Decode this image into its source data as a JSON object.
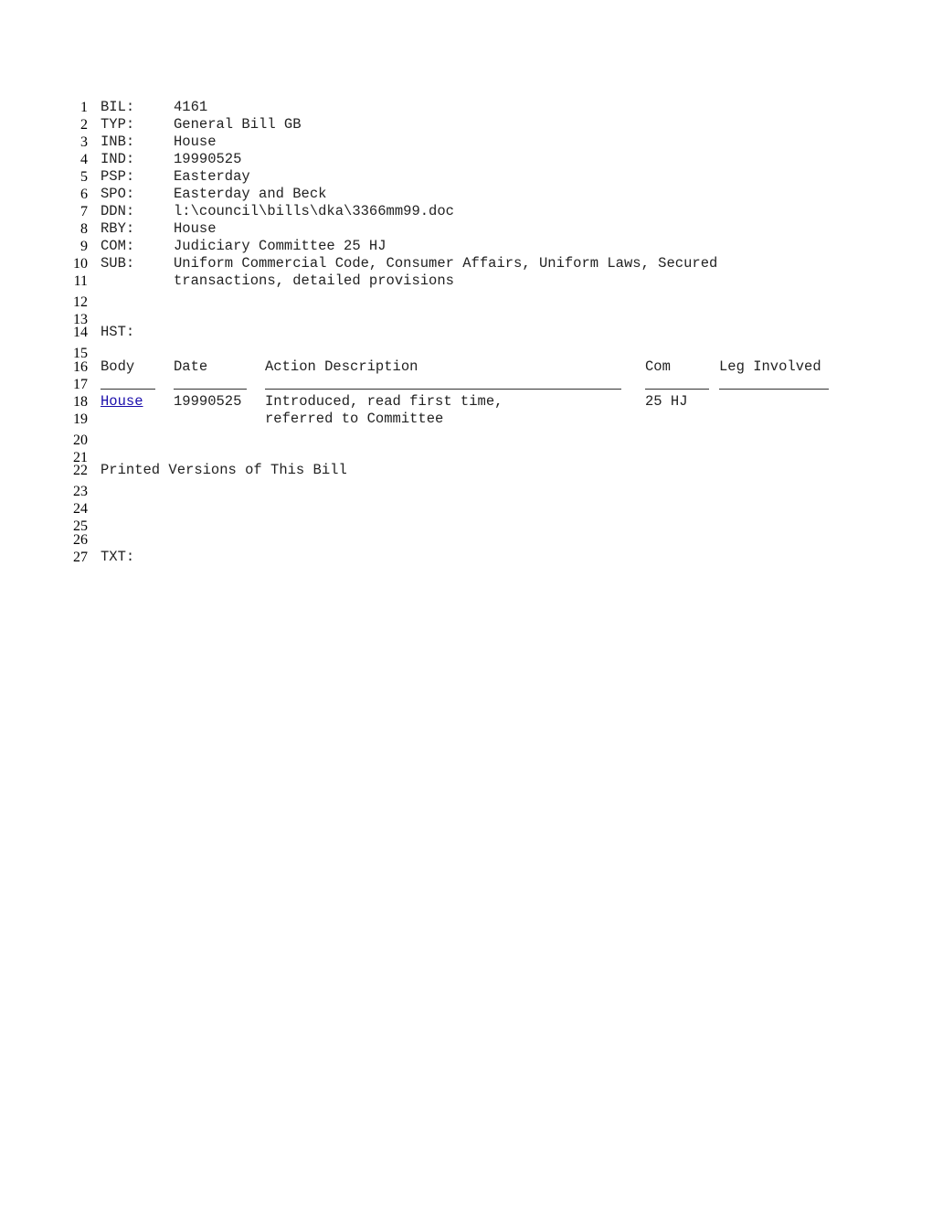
{
  "fields": [
    {
      "num": "1",
      "label": "BIL:",
      "value": "4161"
    },
    {
      "num": "2",
      "label": "TYP:",
      "value": "General Bill GB"
    },
    {
      "num": "3",
      "label": "INB:",
      "value": "House"
    },
    {
      "num": "4",
      "label": "IND:",
      "value": "19990525"
    },
    {
      "num": "5",
      "label": "PSP:",
      "value": "Easterday"
    },
    {
      "num": "6",
      "label": "SPO:",
      "value": "Easterday and Beck"
    },
    {
      "num": "7",
      "label": "DDN:",
      "value": "l:\\council\\bills\\dka\\3366mm99.doc"
    },
    {
      "num": "8",
      "label": "RBY:",
      "value": "House"
    },
    {
      "num": "9",
      "label": "COM:",
      "value": "Judiciary Committee 25 HJ"
    },
    {
      "num": "10",
      "label": "SUB:",
      "value": "Uniform Commercial Code, Consumer Affairs, Uniform Laws, Secured"
    },
    {
      "num": "11",
      "label": "",
      "value": "transactions, detailed provisions"
    }
  ],
  "blank_lines": {
    "l12": "12",
    "l13": "13",
    "l15": "15",
    "l17": "17",
    "l20": "20",
    "l21": "21",
    "l23": "23",
    "l24": "24",
    "l25": "25",
    "l26": "26"
  },
  "history": {
    "num": "14",
    "label": "HST:",
    "header_num": "16",
    "columns": [
      "Body",
      "Date",
      "Action Description",
      "Com",
      "Leg Involved"
    ],
    "rows": [
      {
        "num": "18",
        "body": "House",
        "date": "19990525",
        "action": "Introduced, read first time,",
        "com": "25 HJ",
        "leg": ""
      },
      {
        "num": "19",
        "body": "",
        "date": "",
        "action": "referred to Committee",
        "com": "",
        "leg": ""
      }
    ]
  },
  "printed_versions": {
    "num": "22",
    "label": "Printed Versions of This Bill"
  },
  "text_section": {
    "num": "27",
    "label": "TXT:"
  },
  "colors": {
    "link": "#1a0dab",
    "text": "#222222"
  }
}
